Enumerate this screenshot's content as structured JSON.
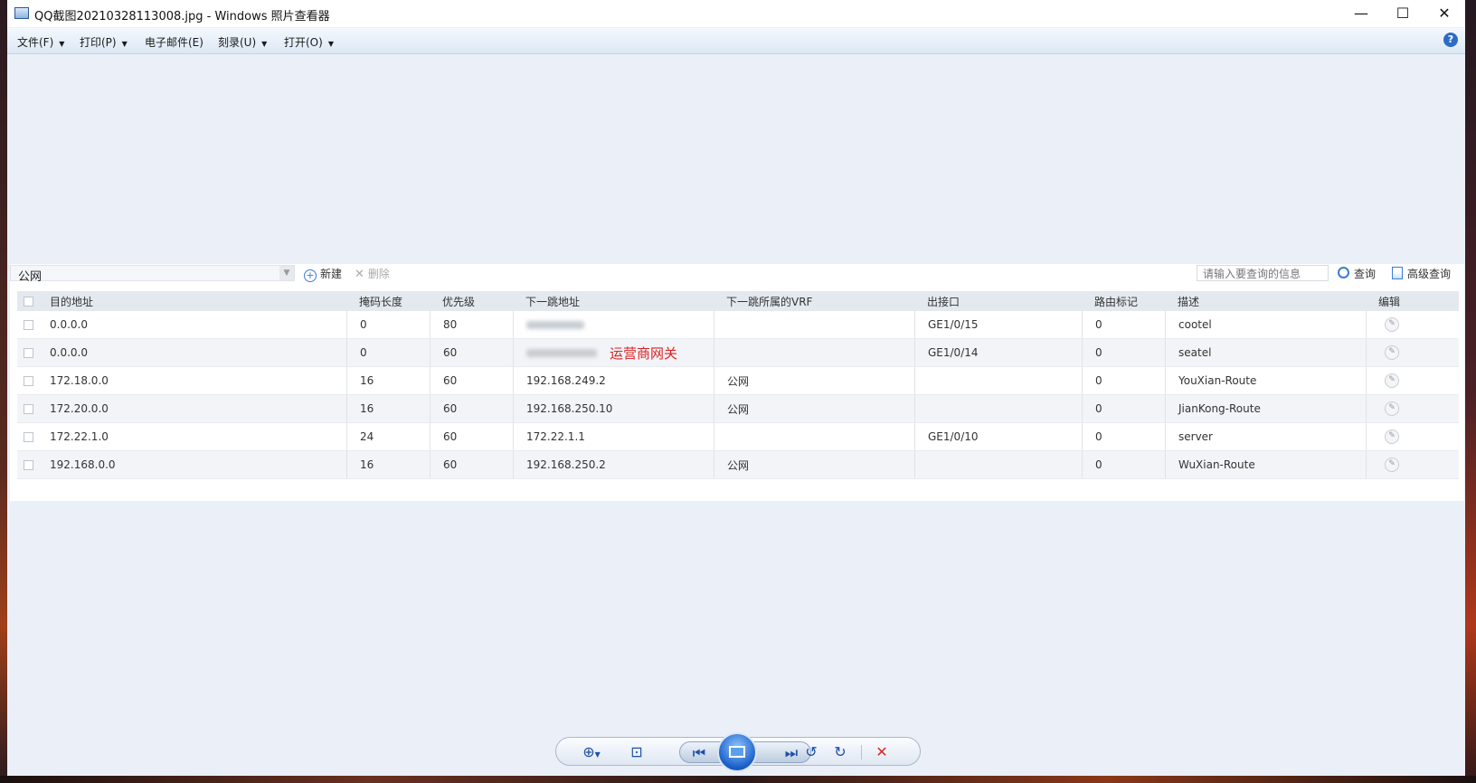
{
  "window": {
    "title": "QQ截图20210328113008.jpg - Windows 照片查看器",
    "minimize_glyph": "—",
    "maximize_glyph": "☐",
    "close_glyph": "✕"
  },
  "menu": {
    "items": [
      {
        "label": "文件(F)"
      },
      {
        "label": "打印(P)"
      },
      {
        "label": "电子邮件(E)"
      },
      {
        "label": "刻录(U)"
      },
      {
        "label": "打开(O)"
      }
    ],
    "arrow_glyph": "▼",
    "help_glyph": "?"
  },
  "app": {
    "vrf_select_value": "公网",
    "new_label": "新建",
    "delete_label": "删除",
    "search_placeholder": "请输入要查询的信息",
    "search_label": "查询",
    "advanced_label": "高级查询",
    "annotation": "运营商网关",
    "table": {
      "headers": [
        "目的地址",
        "掩码长度",
        "优先级",
        "下一跳地址",
        "下一跳所属的VRF",
        "出接口",
        "路由标记",
        "描述",
        "编辑"
      ],
      "rows": [
        {
          "dest": "0.0.0.0",
          "mask": "0",
          "priority": "80",
          "nexthop": "",
          "vrf": "",
          "iface": "GE1/0/15",
          "tag": "0",
          "desc": "cootel"
        },
        {
          "dest": "0.0.0.0",
          "mask": "0",
          "priority": "60",
          "nexthop": "",
          "vrf": "",
          "iface": "GE1/0/14",
          "tag": "0",
          "desc": "seatel"
        },
        {
          "dest": "172.18.0.0",
          "mask": "16",
          "priority": "60",
          "nexthop": "192.168.249.2",
          "vrf": "公网",
          "iface": "",
          "tag": "0",
          "desc": "YouXian-Route"
        },
        {
          "dest": "172.20.0.0",
          "mask": "16",
          "priority": "60",
          "nexthop": "192.168.250.10",
          "vrf": "公网",
          "iface": "",
          "tag": "0",
          "desc": "JianKong-Route"
        },
        {
          "dest": "172.22.1.0",
          "mask": "24",
          "priority": "60",
          "nexthop": "172.22.1.1",
          "vrf": "",
          "iface": "GE1/0/10",
          "tag": "0",
          "desc": "server"
        },
        {
          "dest": "192.168.0.0",
          "mask": "16",
          "priority": "60",
          "nexthop": "192.168.250.2",
          "vrf": "公网",
          "iface": "",
          "tag": "0",
          "desc": "WuXian-Route"
        }
      ]
    }
  },
  "colors": {
    "accent": "#3d7bd6",
    "annotation": "#e02020",
    "delete": "#d42a2a"
  }
}
